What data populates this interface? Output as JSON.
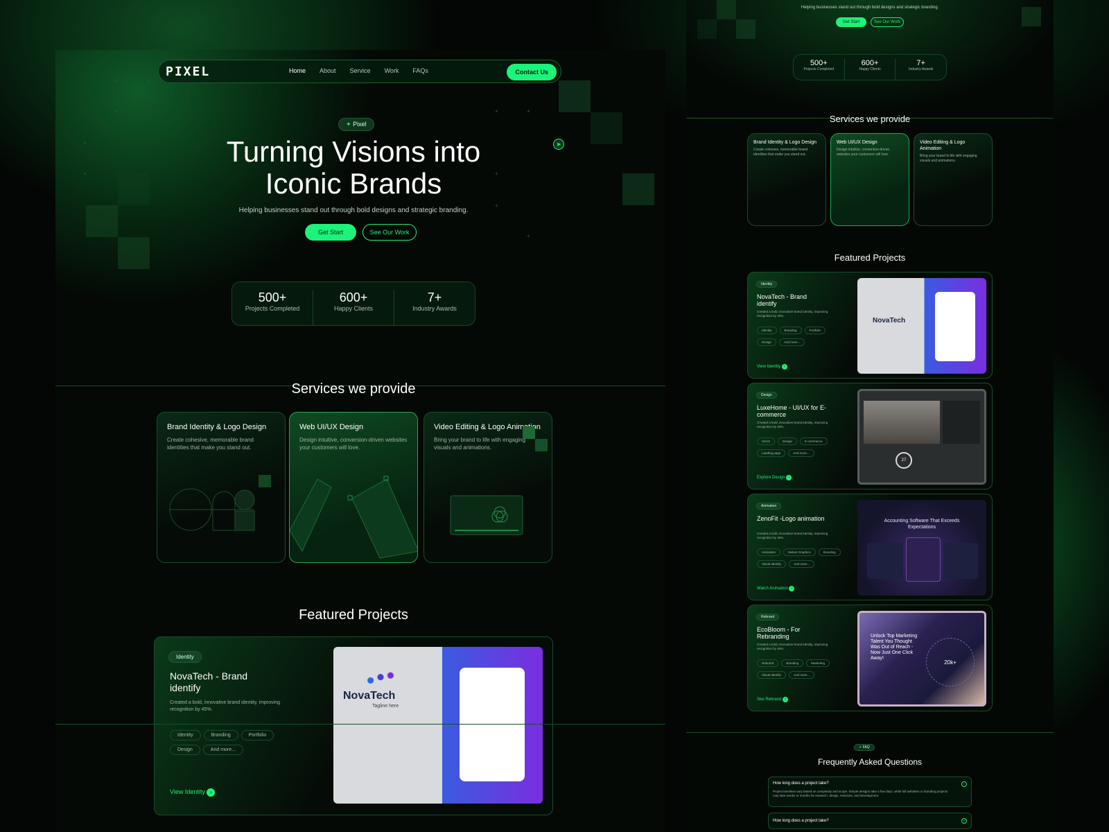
{
  "brand": {
    "logo": "PIXEL"
  },
  "nav": {
    "links": [
      "Home",
      "About",
      "Service",
      "Work",
      "FAQs"
    ],
    "contact": "Contact Us"
  },
  "hero": {
    "badge": "Pixel",
    "title_line1": "Turning Visions into",
    "title_line2": "Iconic Brands",
    "subtitle": "Helping businesses stand out through bold designs and strategic branding.",
    "cta_primary": "Get Start",
    "cta_secondary": "See Our Work"
  },
  "stats": [
    {
      "value": "500+",
      "label": "Projects Completed"
    },
    {
      "value": "600+",
      "label": "Happy Clients"
    },
    {
      "value": "7+",
      "label": "Industry Awards"
    }
  ],
  "services": {
    "title": "Services we provide",
    "items": [
      {
        "title": "Brand Identity & Logo Design",
        "desc": "Create cohesive, memorable brand identities that make you stand out."
      },
      {
        "title": "Web UI/UX Design",
        "desc": "Design intuitive, conversion-driven websites your customers will love."
      },
      {
        "title": "Video Editing & Logo Animation",
        "desc": "Bring your brand to life with engaging visuals and animations."
      }
    ]
  },
  "projects": {
    "title": "Featured Projects",
    "items": [
      {
        "category": "Identity",
        "title": "NovaTech - Brand identify",
        "desc": "Created a bold, innovative brand identity, improving recognition by 45%.",
        "tags": [
          "Identity",
          "Branding",
          "Portfolio",
          "Design",
          "And more..."
        ],
        "link": "View Identity",
        "mock_title": "NovaTech",
        "mock_sub": "Tagline here"
      },
      {
        "category": "Design",
        "title": "LuxeHome - UI/UX for E-commerce",
        "desc": "Created a bold, innovative brand identity, improving recognition by 45%.",
        "tags": [
          "UI/UX",
          "Design",
          "E-commerce",
          "Landing page",
          "And more..."
        ],
        "link": "Explore Design",
        "mock_stat": "27"
      },
      {
        "category": "Animation",
        "title": "ZenoFit -Logo animation",
        "desc": "Created a bold, innovative brand identity, improving recognition by 45%.",
        "tags": [
          "Animation",
          "Motion Graphics",
          "Branding",
          "Visual Identify",
          "And more..."
        ],
        "link": "Watch Animation",
        "mock_title": "Accounting Software That Exceeds Expectations"
      },
      {
        "category": "Rebrand",
        "title": "EcoBloom - For Rebranding",
        "desc": "Created a bold, innovative brand identity, improving recognition by 45%.",
        "tags": [
          "Rebrand",
          "Branding",
          "Marketing",
          "Visual Identify",
          "And more..."
        ],
        "link": "See Rebrand",
        "mock_title": "Unlock Top Marketing Talent You Thought Was Out of Reach - Now Just One Click Away!",
        "mock_stat": "20k+"
      }
    ]
  },
  "faq": {
    "badge": "FAQ",
    "title": "Frequently Asked Questions",
    "items": [
      {
        "q": "How long does a project take?",
        "a": "Project timelines vary based on complexity and scope. Simple designs take a few days, while full websites or branding projects may take weeks or months for research, design, revisions, and development."
      },
      {
        "q": "How long does a project take?",
        "a": ""
      }
    ]
  },
  "colors": {
    "accent": "#1df27a",
    "bg": "#030604",
    "border": "#1a4c2c"
  }
}
